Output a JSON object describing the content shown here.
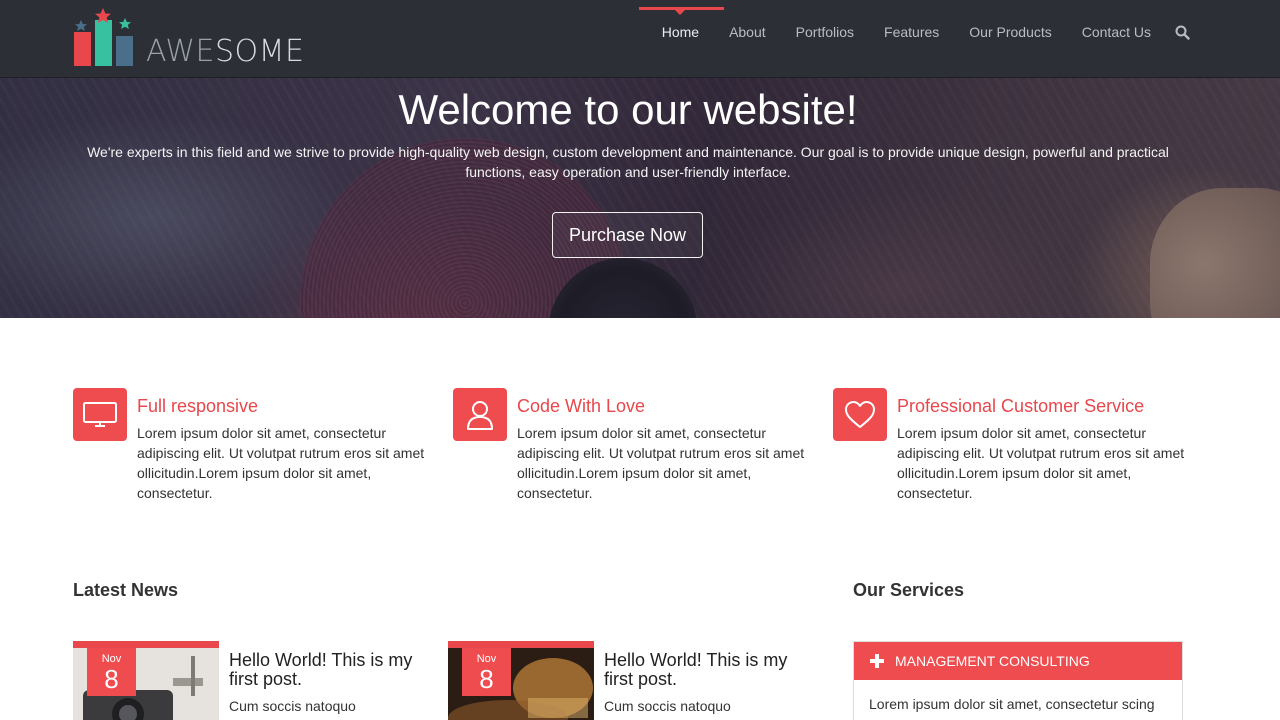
{
  "brand": {
    "logo_light": "AWE",
    "logo_bold": "SOME"
  },
  "nav": {
    "items": [
      {
        "label": "Home"
      },
      {
        "label": "About"
      },
      {
        "label": "Portfolios"
      },
      {
        "label": "Features"
      },
      {
        "label": "Our Products"
      },
      {
        "label": "Contact Us"
      }
    ],
    "active": "Home",
    "search_icon": "search-icon"
  },
  "hero": {
    "title": "Welcome to our website!",
    "subtitle": "We're experts in this field and we strive to provide high-quality web design, custom development and maintenance. Our goal is to provide unique design, powerful and practical functions, easy operation and user-friendly interface.",
    "button": "Purchase Now"
  },
  "features": [
    {
      "icon": "monitor-icon",
      "title": "Full responsive",
      "text": "Lorem ipsum dolor sit amet, consectetur adipiscing elit. Ut volutpat rutrum eros sit amet ollicitudin.Lorem ipsum dolor sit amet, consectetur."
    },
    {
      "icon": "user-icon",
      "title": "Code With Love",
      "text": "Lorem ipsum dolor sit amet, consectetur adipiscing elit. Ut volutpat rutrum eros sit amet ollicitudin.Lorem ipsum dolor sit amet, consectetur."
    },
    {
      "icon": "heart-icon",
      "title": "Professional Customer Service",
      "text": "Lorem ipsum dolor sit amet, consectetur adipiscing elit. Ut volutpat rutrum eros sit amet ollicitudin.Lorem ipsum dolor sit amet, consectetur."
    }
  ],
  "news": {
    "heading": "Latest News",
    "posts": [
      {
        "month": "Nov",
        "day": "8",
        "title": "Hello World! This is my first post.",
        "excerpt": "Cum soccis natoquo"
      },
      {
        "month": "Nov",
        "day": "8",
        "title": "Hello World! This is my first post.",
        "excerpt": "Cum soccis natoquo"
      }
    ]
  },
  "services": {
    "heading": "Our Services",
    "item_title": "MANAGEMENT CONSULTING",
    "item_text": "Lorem ipsum dolor sit amet, consectetur scing"
  },
  "colors": {
    "accent": "#ef4c4f",
    "header_bg": "#2c3036"
  }
}
